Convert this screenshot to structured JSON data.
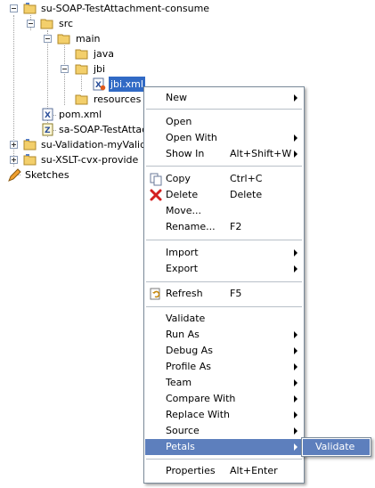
{
  "tree": {
    "items": [
      {
        "label": "su-SOAP-TestAttachment-consume"
      },
      {
        "label": "src"
      },
      {
        "label": "main"
      },
      {
        "label": "java"
      },
      {
        "label": "jbi"
      },
      {
        "label": "jbi.xml"
      },
      {
        "label": "resources"
      },
      {
        "label": "pom.xml"
      },
      {
        "label": "sa-SOAP-TestAttac"
      },
      {
        "label": "su-Validation-myValidati"
      },
      {
        "label": "su-XSLT-cvx-provide"
      },
      {
        "label": "Sketches"
      }
    ]
  },
  "context_menu": {
    "items": [
      {
        "label": "New",
        "shortcut": "",
        "submenu": true
      },
      {
        "label": "Open",
        "shortcut": ""
      },
      {
        "label": "Open With",
        "shortcut": "",
        "submenu": true
      },
      {
        "label": "Show In",
        "shortcut": "Alt+Shift+W",
        "submenu": true
      },
      {
        "label": "Copy",
        "shortcut": "Ctrl+C",
        "icon": "copy-icon"
      },
      {
        "label": "Delete",
        "shortcut": "Delete",
        "icon": "delete-icon"
      },
      {
        "label": "Move...",
        "shortcut": ""
      },
      {
        "label": "Rename...",
        "shortcut": "F2"
      },
      {
        "label": "Import",
        "shortcut": "",
        "submenu": true
      },
      {
        "label": "Export",
        "shortcut": "",
        "submenu": true
      },
      {
        "label": "Refresh",
        "shortcut": "F5",
        "icon": "refresh-icon"
      },
      {
        "label": "Validate",
        "shortcut": ""
      },
      {
        "label": "Run As",
        "shortcut": "",
        "submenu": true
      },
      {
        "label": "Debug As",
        "shortcut": "",
        "submenu": true
      },
      {
        "label": "Profile As",
        "shortcut": "",
        "submenu": true
      },
      {
        "label": "Team",
        "shortcut": "",
        "submenu": true
      },
      {
        "label": "Compare With",
        "shortcut": "",
        "submenu": true
      },
      {
        "label": "Replace With",
        "shortcut": "",
        "submenu": true
      },
      {
        "label": "Source",
        "shortcut": "",
        "submenu": true
      },
      {
        "label": "Petals",
        "shortcut": "",
        "submenu": true,
        "highlighted": true
      },
      {
        "label": "Properties",
        "shortcut": "Alt+Enter"
      }
    ]
  },
  "submenu": {
    "items": [
      {
        "label": "Validate",
        "highlighted": true
      }
    ]
  },
  "colors": {
    "highlight": "#5d7fbd",
    "selection": "#316ac5",
    "folder": "#f3cf6b"
  }
}
